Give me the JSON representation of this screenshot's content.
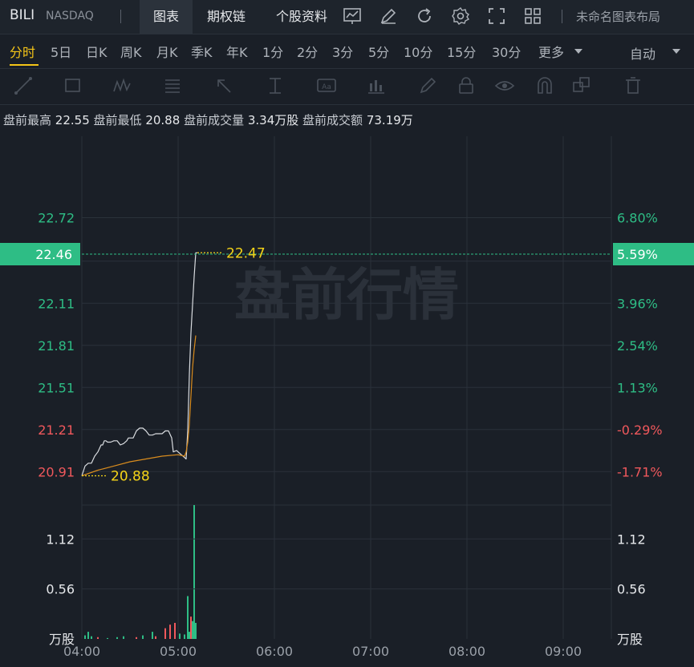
{
  "header": {
    "ticker": "BILI",
    "exchange": "NASDAQ",
    "tabs": [
      {
        "label": "图表",
        "active": true
      },
      {
        "label": "期权链",
        "active": false
      },
      {
        "label": "个股资料",
        "active": false
      }
    ],
    "icons": [
      "chart-line-icon",
      "edit-icon",
      "refresh-icon",
      "settings-icon",
      "fullscreen-icon",
      "layout-grid-icon"
    ],
    "layout_name": "未命名图表布局"
  },
  "periods": {
    "items": [
      "分时",
      "5日",
      "日K",
      "周K",
      "月K",
      "季K",
      "年K",
      "1分",
      "2分",
      "3分",
      "5分",
      "10分",
      "15分",
      "30分",
      "更多"
    ],
    "active_index": 0,
    "auto_label": "自动"
  },
  "drawing_tools": [
    "trendline-icon",
    "rectangle-icon",
    "pattern-icon",
    "fib-icon",
    "arrow-icon",
    "measure-icon",
    "text-icon",
    "bar-pattern-icon",
    "pen-icon",
    "lock-icon",
    "eye-icon",
    "magnet-icon",
    "clone-icon",
    "trash-icon"
  ],
  "stats": {
    "high_label": "盘前最高",
    "high_value": "22.55",
    "low_label": "盘前最低",
    "low_value": "20.88",
    "volume_label": "盘前成交量",
    "volume_value": "3.34万股",
    "amount_label": "盘前成交额",
    "amount_value": "73.19万"
  },
  "colors": {
    "up": "#2ebd85",
    "down": "#f0585c",
    "price_line": "#d9dce0",
    "avg_line": "#d98c1e",
    "annotation": "#f5d418",
    "background": "#1a1f27",
    "grid": "#2a313a"
  },
  "chart_data": {
    "type": "line",
    "watermark": "盘前行情",
    "x_ticks": [
      "04:00",
      "05:00",
      "06:00",
      "07:00",
      "08:00",
      "09:00"
    ],
    "x_range_minutes": [
      0,
      330
    ],
    "price_axis": {
      "range": [
        20.7,
        23.3
      ],
      "ticks": [
        {
          "price": "22.72",
          "pct": "6.80%",
          "dir": "up"
        },
        {
          "price": "22.11",
          "pct": "3.96%",
          "dir": "up"
        },
        {
          "price": "21.81",
          "pct": "2.54%",
          "dir": "up"
        },
        {
          "price": "21.51",
          "pct": "1.13%",
          "dir": "up"
        },
        {
          "price": "21.21",
          "pct": "-0.29%",
          "dir": "down"
        },
        {
          "price": "20.91",
          "pct": "-1.71%",
          "dir": "down"
        }
      ]
    },
    "current_price": {
      "value": 22.46,
      "label": "22.46",
      "pct": "5.59%"
    },
    "annotations": [
      {
        "label": "22.47",
        "t": 72,
        "price": 22.47
      },
      {
        "label": "20.88",
        "t": 0,
        "price": 20.88
      }
    ],
    "series": [
      {
        "points": [
          [
            0,
            20.88
          ],
          [
            2,
            20.95
          ],
          [
            4,
            20.97
          ],
          [
            6,
            20.97
          ],
          [
            8,
            21.02
          ],
          [
            10,
            21.05
          ],
          [
            12,
            21.1
          ],
          [
            13,
            21.1
          ],
          [
            14,
            21.13
          ],
          [
            15,
            21.13
          ],
          [
            16,
            21.12
          ],
          [
            18,
            21.12
          ],
          [
            20,
            21.13
          ],
          [
            22,
            21.13
          ],
          [
            24,
            21.1
          ],
          [
            26,
            21.11
          ],
          [
            28,
            21.13
          ],
          [
            29,
            21.15
          ],
          [
            30,
            21.15
          ],
          [
            32,
            21.15
          ],
          [
            34,
            21.2
          ],
          [
            36,
            21.22
          ],
          [
            38,
            21.22
          ],
          [
            40,
            21.2
          ],
          [
            42,
            21.17
          ],
          [
            44,
            21.17
          ],
          [
            46,
            21.18
          ],
          [
            48,
            21.18
          ],
          [
            50,
            21.18
          ],
          [
            52,
            21.2
          ],
          [
            54,
            21.2
          ],
          [
            56,
            21.15
          ],
          [
            57,
            21.05
          ],
          [
            59,
            21.06
          ],
          [
            60,
            21.05
          ],
          [
            62,
            21.03
          ],
          [
            64,
            21.01
          ],
          [
            65,
            21.0
          ],
          [
            66,
            21.2
          ],
          [
            67,
            21.6
          ],
          [
            68,
            21.9
          ],
          [
            69,
            22.1
          ],
          [
            70,
            22.3
          ],
          [
            71,
            22.47
          ],
          [
            72,
            22.47
          ]
        ]
      },
      {
        "points": [
          [
            0,
            20.88
          ],
          [
            5,
            20.9
          ],
          [
            10,
            20.92
          ],
          [
            20,
            20.95
          ],
          [
            30,
            20.98
          ],
          [
            40,
            21.0
          ],
          [
            50,
            21.02
          ],
          [
            60,
            21.03
          ],
          [
            64,
            21.02
          ],
          [
            65,
            21.05
          ],
          [
            66,
            21.12
          ],
          [
            67,
            21.25
          ],
          [
            68,
            21.45
          ],
          [
            69,
            21.65
          ],
          [
            70,
            21.78
          ],
          [
            71,
            21.88
          ]
        ]
      }
    ],
    "volume": {
      "axis_ticks": [
        "1.12",
        "0.56"
      ],
      "unit_label": "万股",
      "max": 1.5,
      "bars": [
        {
          "t": 2,
          "v": 0.04,
          "dir": "up"
        },
        {
          "t": 4,
          "v": 0.08,
          "dir": "up"
        },
        {
          "t": 6,
          "v": 0.03,
          "dir": "up"
        },
        {
          "t": 10,
          "v": 0.02,
          "dir": "down"
        },
        {
          "t": 16,
          "v": 0.01,
          "dir": "up"
        },
        {
          "t": 22,
          "v": 0.02,
          "dir": "up"
        },
        {
          "t": 26,
          "v": 0.03,
          "dir": "up"
        },
        {
          "t": 34,
          "v": 0.02,
          "dir": "down"
        },
        {
          "t": 38,
          "v": 0.04,
          "dir": "up"
        },
        {
          "t": 44,
          "v": 0.08,
          "dir": "up"
        },
        {
          "t": 46,
          "v": 0.03,
          "dir": "down"
        },
        {
          "t": 52,
          "v": 0.12,
          "dir": "down"
        },
        {
          "t": 55,
          "v": 0.16,
          "dir": "down"
        },
        {
          "t": 58,
          "v": 0.18,
          "dir": "down"
        },
        {
          "t": 61,
          "v": 0.06,
          "dir": "up"
        },
        {
          "t": 64,
          "v": 0.05,
          "dir": "up"
        },
        {
          "t": 66,
          "v": 0.48,
          "dir": "up"
        },
        {
          "t": 67,
          "v": 0.08,
          "dir": "up"
        },
        {
          "t": 68,
          "v": 0.25,
          "dir": "down"
        },
        {
          "t": 69,
          "v": 0.2,
          "dir": "up"
        },
        {
          "t": 70,
          "v": 1.5,
          "dir": "up"
        },
        {
          "t": 71,
          "v": 0.18,
          "dir": "up"
        }
      ]
    }
  }
}
